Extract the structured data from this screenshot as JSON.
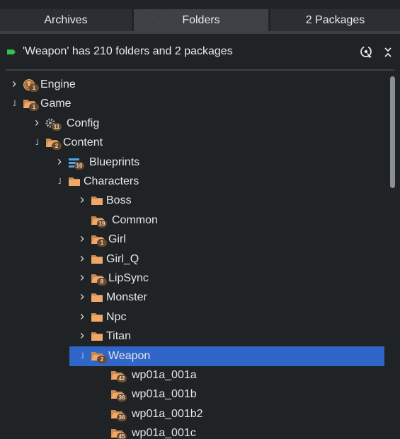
{
  "tabs": [
    {
      "label": "Archives",
      "active": false
    },
    {
      "label": "Folders",
      "active": true
    },
    {
      "label": "2 Packages",
      "active": false
    }
  ],
  "status": {
    "message": "'Weapon' has 210 folders and 2 packages",
    "indicator_color": "#33c24a",
    "locate_icon": "locate-icon",
    "collapse_icon": "collapse-all-icon"
  },
  "colors": {
    "background": "#1f2326",
    "selection": "#2f66c8",
    "folder": "#f0a868",
    "badge": "#6b4a2c"
  },
  "tree": [
    {
      "label": "Engine",
      "expander": "collapsed",
      "icon": "engine-icon",
      "badge": "1",
      "depth": 0
    },
    {
      "label": "Game",
      "expander": "expanded",
      "icon": "folder-open-icon",
      "badge": "1",
      "depth": 0
    },
    {
      "label": "Config",
      "expander": "collapsed",
      "icon": "config-icon",
      "badge": "11",
      "depth": 1
    },
    {
      "label": "Content",
      "expander": "expanded",
      "icon": "folder-open-icon",
      "badge": "2",
      "depth": 1
    },
    {
      "label": "Blueprints",
      "expander": "collapsed",
      "icon": "blueprint-icon",
      "badge": "10",
      "depth": 2
    },
    {
      "label": "Characters",
      "expander": "expanded",
      "icon": "folder-icon",
      "badge": "",
      "depth": 2
    },
    {
      "label": "Boss",
      "expander": "collapsed",
      "icon": "folder-icon",
      "badge": "",
      "depth": 3
    },
    {
      "label": "Common",
      "expander": "none",
      "icon": "folder-open-icon",
      "badge": "19",
      "depth": 3
    },
    {
      "label": "Girl",
      "expander": "collapsed",
      "icon": "folder-open-icon",
      "badge": "1",
      "depth": 3
    },
    {
      "label": "Girl_Q",
      "expander": "collapsed",
      "icon": "folder-icon",
      "badge": "",
      "depth": 3
    },
    {
      "label": "LipSync",
      "expander": "collapsed",
      "icon": "folder-open-icon",
      "badge": "8",
      "depth": 3
    },
    {
      "label": "Monster",
      "expander": "collapsed",
      "icon": "folder-icon",
      "badge": "",
      "depth": 3
    },
    {
      "label": "Npc",
      "expander": "collapsed",
      "icon": "folder-icon",
      "badge": "",
      "depth": 3
    },
    {
      "label": "Titan",
      "expander": "collapsed",
      "icon": "folder-icon",
      "badge": "",
      "depth": 3
    },
    {
      "label": "Weapon",
      "expander": "expanded",
      "icon": "folder-open-icon",
      "badge": "2",
      "depth": 3,
      "selected": true
    },
    {
      "label": "wp01a_001a",
      "expander": "none",
      "icon": "folder-open-icon",
      "badge": "42",
      "depth": 4
    },
    {
      "label": "wp01a_001b",
      "expander": "none",
      "icon": "folder-open-icon",
      "badge": "36",
      "depth": 4
    },
    {
      "label": "wp01a_001b2",
      "expander": "none",
      "icon": "folder-open-icon",
      "badge": "36",
      "depth": 4
    },
    {
      "label": "wp01a_001c",
      "expander": "none",
      "icon": "folder-open-icon",
      "badge": "45",
      "depth": 4
    }
  ]
}
